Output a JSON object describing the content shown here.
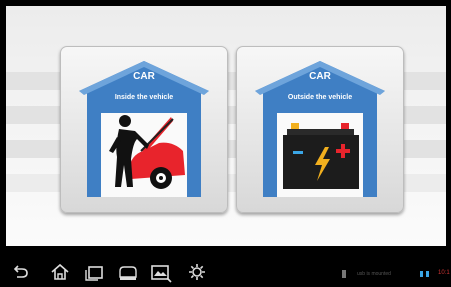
{
  "cards": [
    {
      "title": "CAR",
      "subtitle": "Inside the vehicle",
      "illustration": "mechanic-car-icon",
      "accent": "#3f7fc4"
    },
    {
      "title": "CAR",
      "subtitle": "Outside the vehicle",
      "illustration": "battery-icon",
      "accent": "#3f7fc4"
    }
  ],
  "navbar": {
    "buttons": [
      "back-icon",
      "home-icon",
      "recent-apps-icon",
      "vci-icon",
      "screenshot-icon",
      "settings-icon"
    ],
    "vci_label": "",
    "status_text": "usb is mounted",
    "time": "10:1"
  },
  "colors": {
    "car_red": "#e8242c",
    "battery_body": "#1c1c1c",
    "bolt": "#f2b01e",
    "minus": "#3ba6e6",
    "plus": "#e8242c"
  }
}
